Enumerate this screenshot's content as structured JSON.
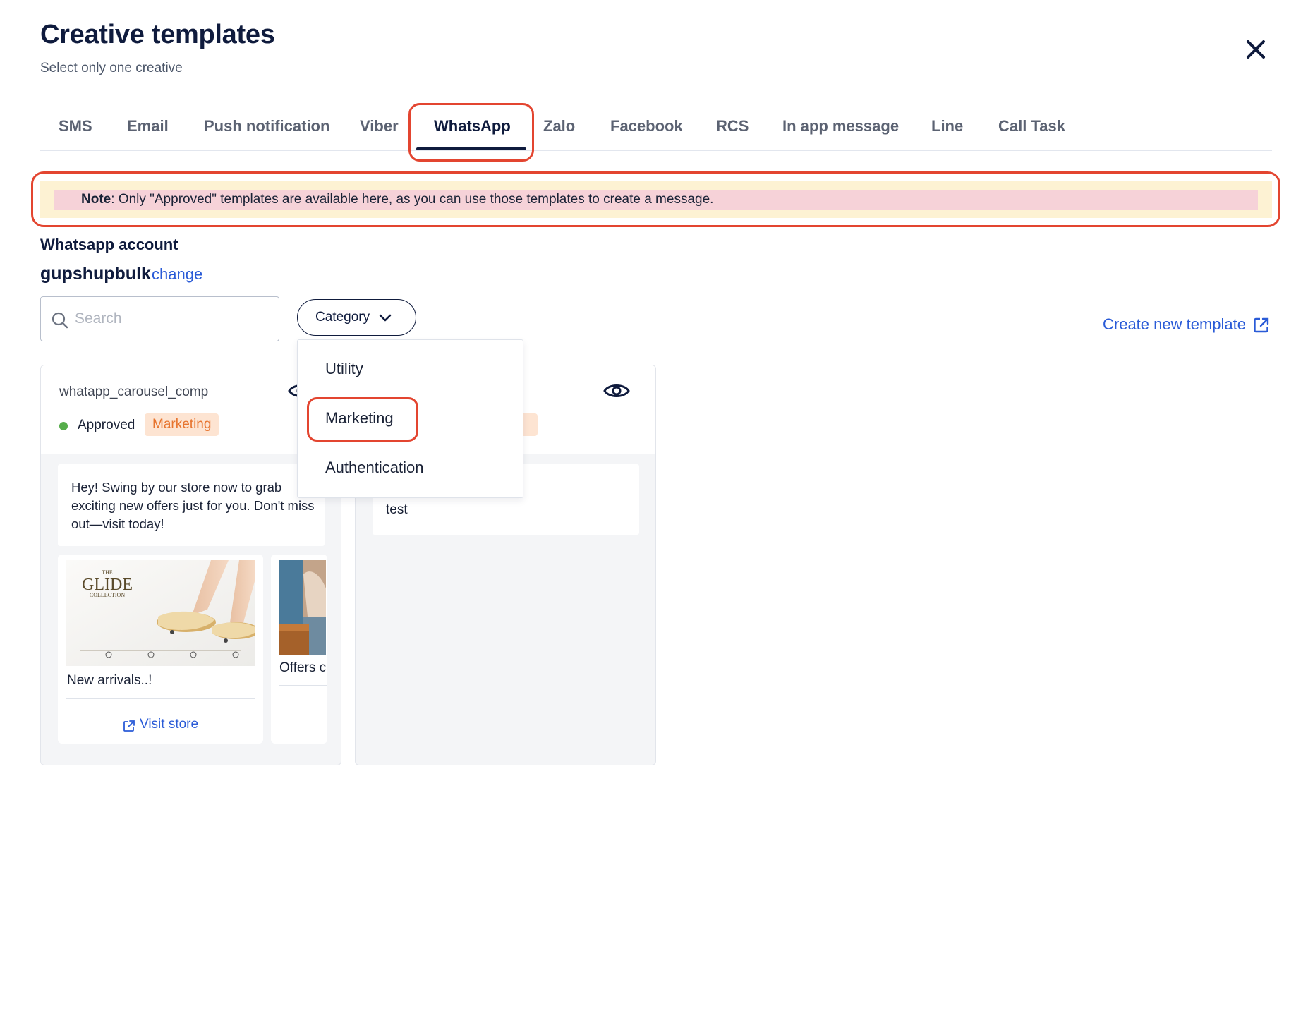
{
  "header": {
    "title": "Creative templates",
    "subtitle": "Select only one creative"
  },
  "tabs": [
    {
      "label": "SMS"
    },
    {
      "label": "Email"
    },
    {
      "label": "Push notification"
    },
    {
      "label": "Viber"
    },
    {
      "label": "WhatsApp",
      "active": true
    },
    {
      "label": "Zalo"
    },
    {
      "label": "Facebook"
    },
    {
      "label": "RCS"
    },
    {
      "label": "In app message"
    },
    {
      "label": "Line"
    },
    {
      "label": "Call Task"
    }
  ],
  "note": {
    "label": "Note",
    "text": ": Only \"Approved\" templates are available here, as you can use those templates to create a message."
  },
  "account": {
    "label": "Whatsapp account",
    "name": "gupshupbulk",
    "change_label": "change"
  },
  "search": {
    "placeholder": "Search"
  },
  "category_filter": {
    "label": "Category",
    "options": [
      "Utility",
      "Marketing",
      "Authentication"
    ]
  },
  "create_template": {
    "label": "Create new template"
  },
  "cards": [
    {
      "name": "whatapp_carousel_comp",
      "status": "Approved",
      "category": "Marketing",
      "message": "Hey! Swing by our store now to grab exciting new offers just for you. Don't miss out—visit today!",
      "carousel": [
        {
          "image_text_1": "THE",
          "image_text_2": "GLIDE",
          "image_text_3": "COLLECTION",
          "caption": "New arrivals..!",
          "button": "Visit store"
        },
        {
          "caption": "Offers c"
        }
      ]
    },
    {
      "category_fragment": "g",
      "message": "test"
    }
  ],
  "colors": {
    "primary_text": "#0f1b3d",
    "link": "#2a5bd7",
    "highlight": "#e34530",
    "approved": "#56ad4b",
    "badge_bg": "#fde4d2",
    "badge_text": "#e7742e",
    "note_bg": "#fdf2d3",
    "note_bar": "#f6d2d8"
  }
}
